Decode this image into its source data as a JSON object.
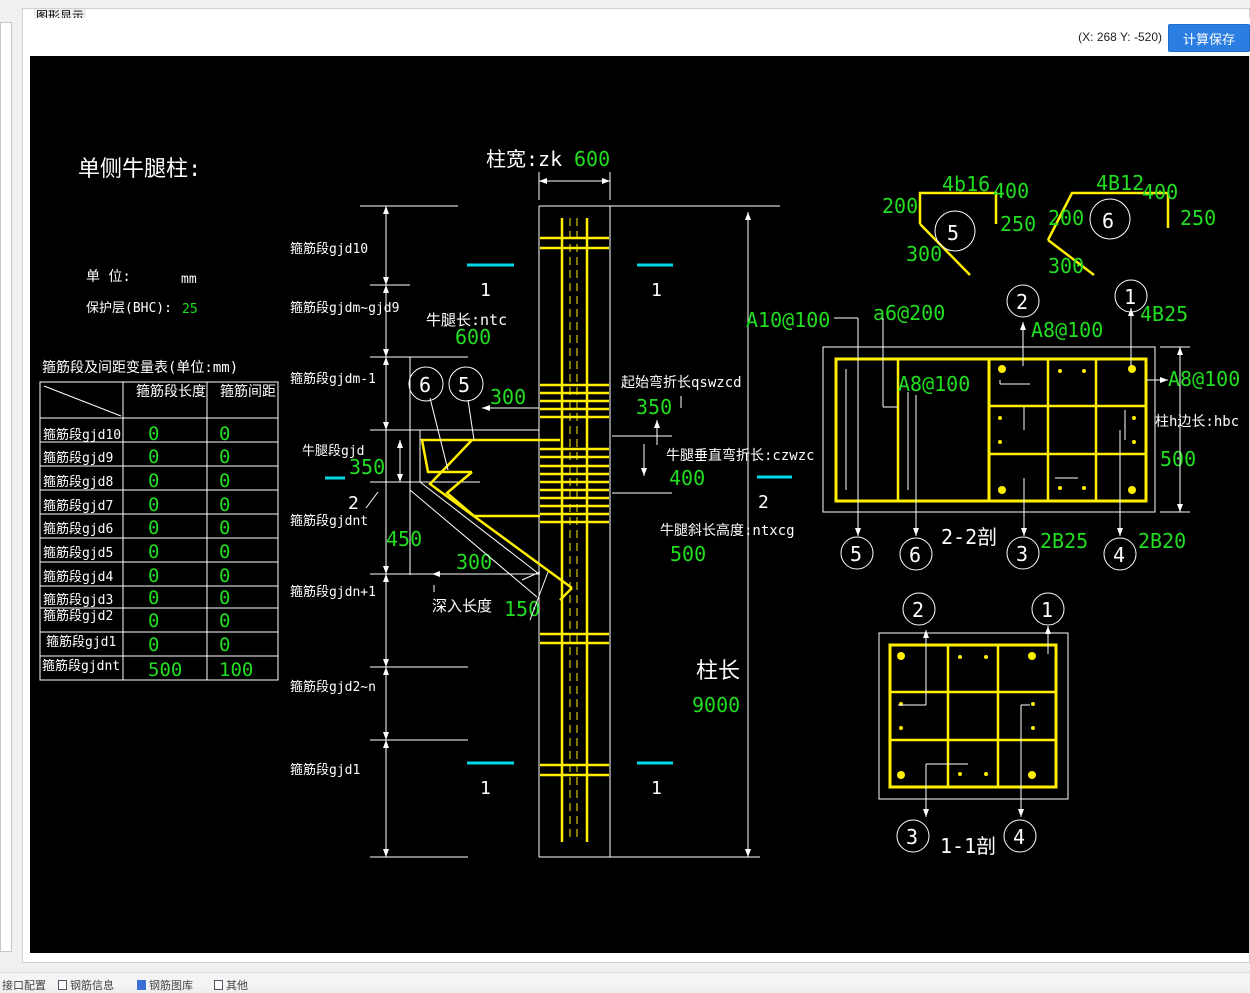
{
  "window": {
    "panel_title": "图形显示"
  },
  "header": {
    "coord_readout": "(X: 268 Y: -520)",
    "save_button": "计算保存"
  },
  "drawing": {
    "title": "单侧牛腿柱:",
    "unit_label": "单  位:",
    "unit_value": "mm",
    "cover_label": "保护层(BHC):",
    "cover_value": "25",
    "table": {
      "caption": "箍筋段及间距变量表(单位:mm)",
      "col_length": "箍筋段长度",
      "col_spacing": "箍筋间距",
      "rows": [
        {
          "name": "箍筋段gjd10",
          "length": "0",
          "spacing": "0"
        },
        {
          "name": "箍筋段gjd9",
          "length": "0",
          "spacing": "0"
        },
        {
          "name": "箍筋段gjd8",
          "length": "0",
          "spacing": "0"
        },
        {
          "name": "箍筋段gjd7",
          "length": "0",
          "spacing": "0"
        },
        {
          "name": "箍筋段gjd6",
          "length": "0",
          "spacing": "0"
        },
        {
          "name": "箍筋段gjd5",
          "length": "0",
          "spacing": "0"
        },
        {
          "name": "箍筋段gjd4",
          "length": "0",
          "spacing": "0"
        },
        {
          "name": "箍筋段gjd3",
          "length": "0",
          "spacing": "0"
        },
        {
          "name": "箍筋段gjd2",
          "length": "0",
          "spacing": "0"
        },
        {
          "name": "箍筋段gjd1",
          "length": "0",
          "spacing": "0"
        },
        {
          "name": "箍筋段gjdnt",
          "length": "500",
          "spacing": "100"
        }
      ]
    },
    "seg_labels": {
      "gjd10": "箍筋段gjd10",
      "gjdm9": "箍筋段gjdm~gjd9",
      "gjdm1": "箍筋段gjdm-1",
      "gjd": "牛腿段gjd",
      "gjdnt": "箍筋段gjdnt",
      "gjdn1": "箍筋段gjdn+1",
      "gjd2n": "箍筋段gjd2~n",
      "gjd1": "箍筋段gjd1"
    },
    "column_width_label": "柱宽:zk",
    "column_width_value": "600",
    "corbel_length_label": "牛腿长:ntc",
    "corbel_length_value": "600",
    "bend_start_label": "起始弯折长qswzcd",
    "bend_start_value": "350",
    "vertical_bend_label": "牛腿垂直弯折长:czwzc",
    "vertical_bend_value": "400",
    "slope_height_label": "牛腿斜长高度:ntxcg",
    "slope_height_value": "500",
    "depth_label": "深入长度",
    "depth_value": "150",
    "column_length_label": "柱长",
    "column_length_value": "9000",
    "dim_300_top": "300",
    "dim_350_left": "350",
    "dim_450": "450",
    "dim_300_bottom": "300",
    "markers": {
      "n1": "1",
      "n2": "2",
      "n3": "3",
      "n4": "4",
      "n5": "5",
      "n6": "6"
    },
    "section22": {
      "title": "2-2剖",
      "a10": "A10@100",
      "a6": "a6@200",
      "a8_top": "A8@100",
      "a8_inner": "A8@100",
      "a8_right": "A8@100",
      "b25_top": "4B25",
      "side_label": "柱h边长:hbc",
      "side_value": "500",
      "b25_bottom": "2B25",
      "b20_bottom": "2B20"
    },
    "section11": {
      "title": "1-1剖"
    },
    "bar5": {
      "label": "4b16",
      "v200": "200",
      "v400": "400",
      "v250": "250",
      "v300": "300"
    },
    "bar6": {
      "label": "4B12",
      "v200": "200",
      "v400": "400",
      "v250": "250",
      "v300": "300"
    }
  },
  "bottom_tabs": [
    "接口配置",
    "钢筋信息",
    "钢筋图库",
    "其他"
  ]
}
